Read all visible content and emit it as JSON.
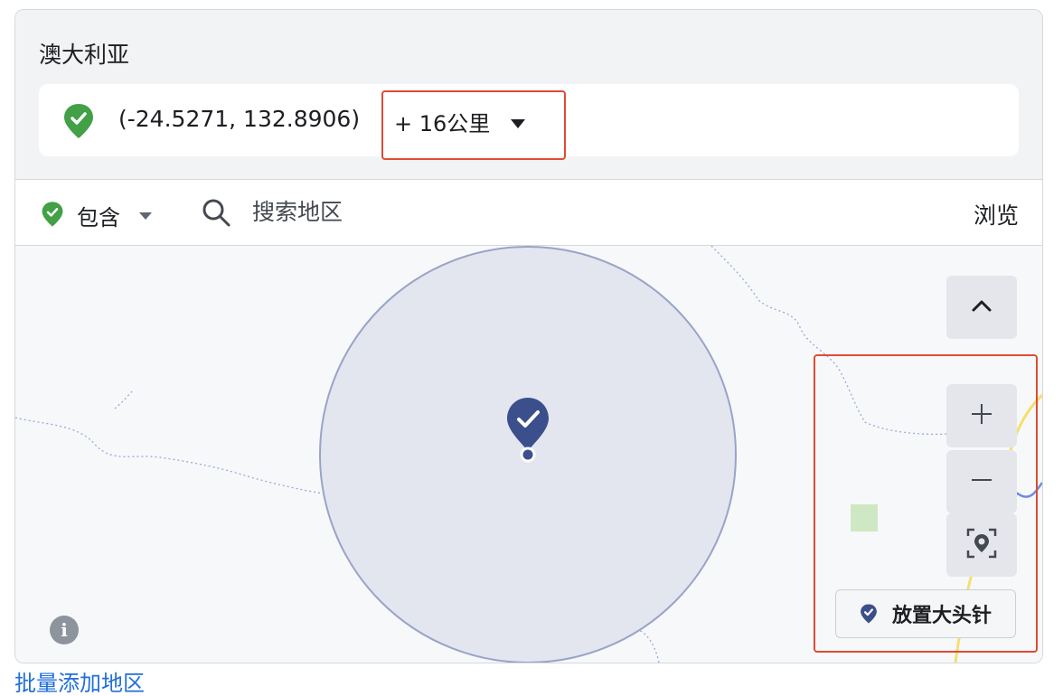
{
  "location": {
    "country": "澳大利亚",
    "coordinates": "(-24.5271, 132.8906)",
    "radius_label": "+ 16公里"
  },
  "toolbar": {
    "include_label": "包含",
    "search_placeholder": "搜索地区",
    "browse_label": "浏览"
  },
  "map": {
    "drop_pin_label": "放置大头针",
    "zoom_in_symbol": "+",
    "zoom_out_symbol": "−",
    "info_symbol": "i"
  },
  "footer": {
    "bulk_add_label": "批量添加地区"
  },
  "colors": {
    "include_green": "#42a046",
    "pin_navy": "#3b4f8c",
    "radius_fill": "#e3e6ef",
    "radius_stroke": "#9aa3c8",
    "highlight_red": "#e04b36",
    "link_blue": "#216fdb"
  },
  "icons": {
    "location": "green-check-pin-icon",
    "radius_dropdown": "caret-down-icon",
    "include_dropdown": "caret-down-icon",
    "search": "search-icon",
    "collapse": "chevron-up-icon",
    "zoom_in": "plus-icon",
    "zoom_out": "minus-icon",
    "locate": "locate-pin-icon",
    "drop_pin": "navy-check-pin-icon",
    "info": "info-icon"
  }
}
